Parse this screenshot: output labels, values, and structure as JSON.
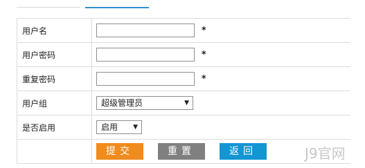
{
  "form": {
    "username_label": "用户名",
    "password_label": "用户密码",
    "confirm_label": "重复密码",
    "group_label": "用户组",
    "enable_label": "是否启用",
    "required_mark": "*",
    "username_value": "",
    "password_value": "",
    "confirm_value": "",
    "group_selected": "超级管理员",
    "enable_selected": "启用"
  },
  "buttons": {
    "submit": "提交",
    "reset": "重置",
    "back": "返回"
  },
  "watermark": "J9官网",
  "colors": {
    "submit": "#f08b1d",
    "reset": "#808080",
    "back": "#1296d4",
    "active_tab_underline": "#2e8fd0"
  },
  "icons": {
    "dropdown": "chevron-down-icon"
  }
}
